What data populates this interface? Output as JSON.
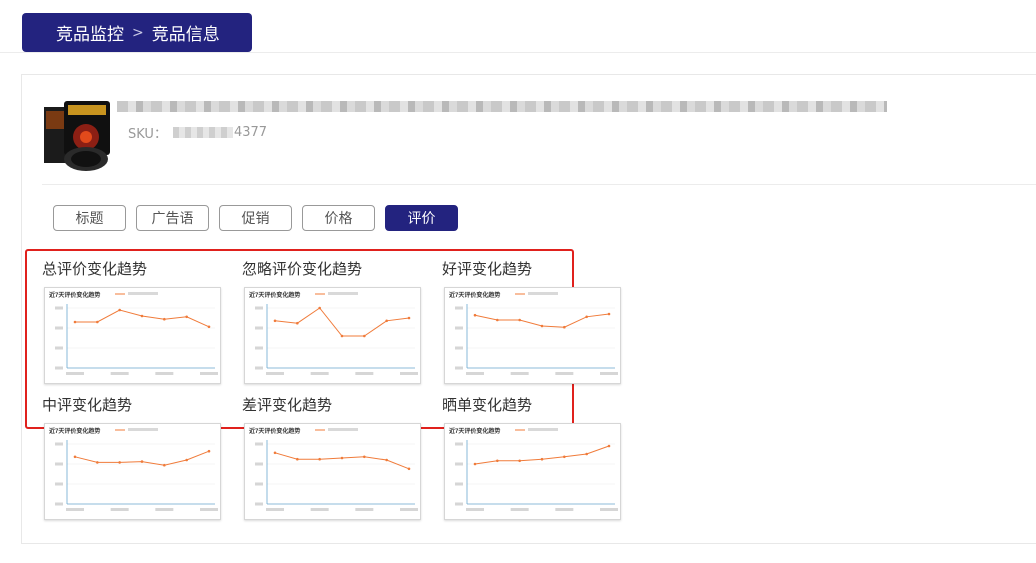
{
  "breadcrumb": {
    "parent": "竞品监控",
    "current": "竞品信息"
  },
  "product": {
    "sku_label": "SKU：",
    "sku_suffix": "4377"
  },
  "tabs": [
    {
      "label": "标题",
      "active": false
    },
    {
      "label": "广告语",
      "active": false
    },
    {
      "label": "促销",
      "active": false
    },
    {
      "label": "价格",
      "active": false
    },
    {
      "label": "评价",
      "active": true
    }
  ],
  "colors": {
    "brand": "#23237f",
    "highlight": "#e0211d",
    "series": "#f07b3a",
    "axis": "#6aa7cf"
  },
  "charts": [
    {
      "title": "总评价变化趋势",
      "inner_title": "近7天评价变化趋势"
    },
    {
      "title": "忽略评价变化趋势",
      "inner_title": "近7天评价变化趋势"
    },
    {
      "title": "好评变化趋势",
      "inner_title": "近7天评价变化趋势"
    },
    {
      "title": "中评变化趋势",
      "inner_title": "近7天评价变化趋势"
    },
    {
      "title": "差评变化趋势",
      "inner_title": "近7天评价变化趋势"
    },
    {
      "title": "晒单变化趋势",
      "inner_title": "近7天评价变化趋势"
    }
  ],
  "chart_data": [
    {
      "type": "line",
      "values": [
        115,
        115,
        145,
        130,
        122,
        128,
        103
      ],
      "ylim": [
        0,
        150
      ]
    },
    {
      "type": "line",
      "values": [
        118,
        112,
        150,
        80,
        80,
        118,
        125
      ],
      "ylim": [
        0,
        150
      ]
    },
    {
      "type": "line",
      "values": [
        132,
        120,
        120,
        105,
        102,
        128,
        135
      ],
      "ylim": [
        0,
        150
      ]
    },
    {
      "type": "line",
      "values": [
        118,
        104,
        104,
        106,
        97,
        110,
        132
      ],
      "ylim": [
        0,
        150
      ]
    },
    {
      "type": "line",
      "values": [
        128,
        112,
        112,
        115,
        118,
        110,
        88
      ],
      "ylim": [
        0,
        150
      ]
    },
    {
      "type": "line",
      "values": [
        100,
        108,
        108,
        112,
        118,
        125,
        145
      ],
      "ylim": [
        0,
        150
      ]
    }
  ]
}
